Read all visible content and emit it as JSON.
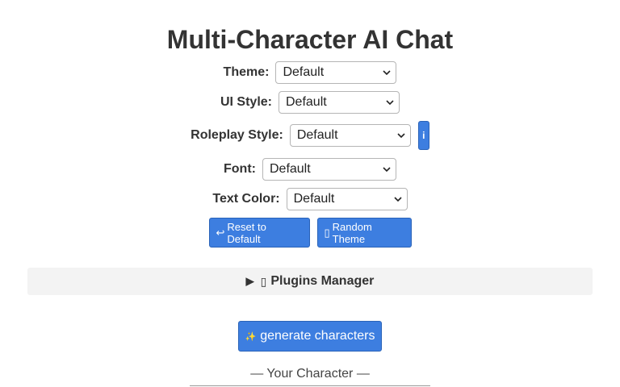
{
  "title": "Multi-Character AI Chat",
  "settings": {
    "theme": {
      "label": "Theme:",
      "value": "Default"
    },
    "ui_style": {
      "label": "UI Style:",
      "value": "Default"
    },
    "roleplay_style": {
      "label": "Roleplay Style:",
      "value": "Default",
      "info_label": "i"
    },
    "font": {
      "label": "Font:",
      "value": "Default"
    },
    "text_color": {
      "label": "Text Color:",
      "value": "Default"
    }
  },
  "buttons": {
    "reset_icon": "↩",
    "reset_label": "Reset to Default",
    "random_icon": "▯",
    "random_label": "Random Theme"
  },
  "plugins": {
    "icon": "▯",
    "label": "Plugins Manager"
  },
  "generate": {
    "icon": "✨",
    "label": "generate characters"
  },
  "your_character": "— Your Character —",
  "colors": {
    "button_blue": "#3d7ee0",
    "plugins_bg": "#f3f3f3",
    "text": "#333333"
  }
}
